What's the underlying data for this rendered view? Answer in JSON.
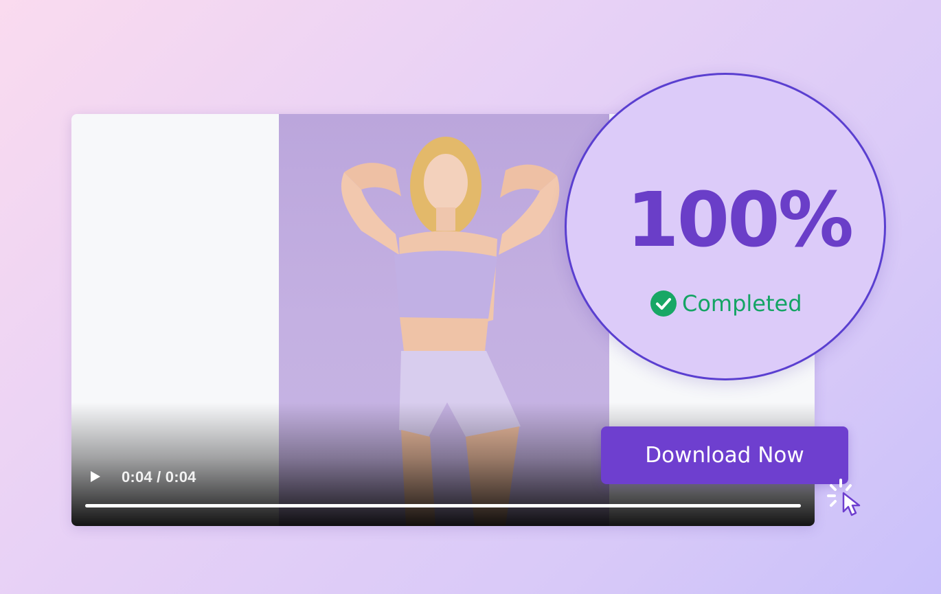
{
  "player": {
    "time_display": "0:04 / 0:04",
    "progress": 1.0,
    "play_icon": "play-icon"
  },
  "status": {
    "percent": "100%",
    "label": "Completed",
    "check_icon": "check-circle-icon"
  },
  "actions": {
    "download_label": "Download Now",
    "cursor_icon": "click-cursor-icon"
  },
  "colors": {
    "accent": "#6e3fcf",
    "success": "#14a464",
    "badge_border": "#5a3fd0"
  }
}
